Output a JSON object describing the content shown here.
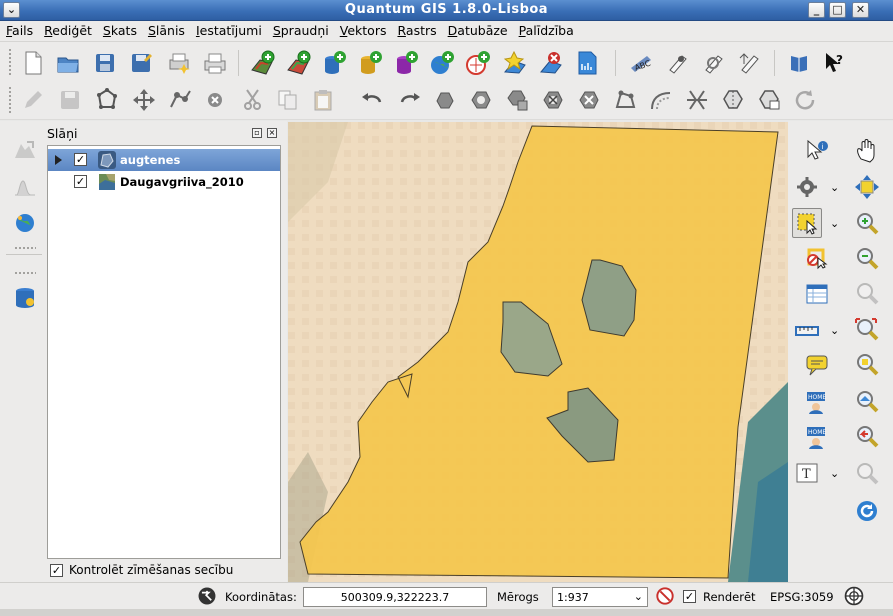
{
  "window": {
    "title": "Quantum GIS 1.8.0-Lisboa"
  },
  "menu": [
    "Fails",
    "Rediģēt",
    "Skats",
    "Slānis",
    "Iestatījumi",
    "Spraudņi",
    "Vektors",
    "Rastrs",
    "Datubāze",
    "Palīdzība"
  ],
  "layers_panel": {
    "title": "Slāņi",
    "layers": [
      {
        "name": "augtenes",
        "checked": true,
        "selected": true,
        "icon": "vector-polygon-layer-icon"
      },
      {
        "name": "Daugavgriiva_2010",
        "checked": true,
        "selected": false,
        "icon": "raster-layer-icon"
      }
    ],
    "control_rendering_order": {
      "label": "Kontrolēt zīmēšanas secību",
      "checked": true
    }
  },
  "statusbar": {
    "coords_label": "Koordinātas:",
    "coords_value": "500309.9,322223.7",
    "scale_label": "Mērogs",
    "scale_value": "1:937",
    "render_label": "Renderēt",
    "render_checked": true,
    "crs": "EPSG:3059"
  },
  "colors": {
    "polygon_fill": "#f4c64c",
    "selection_blue": "#5b86c3",
    "titlebar": "#3a6fb6"
  }
}
